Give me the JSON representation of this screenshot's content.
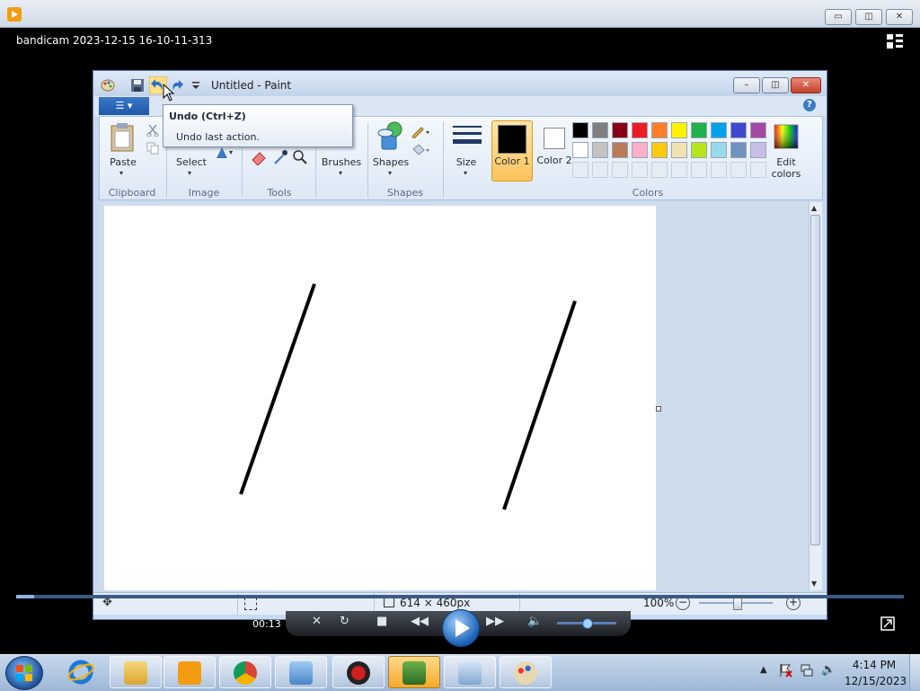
{
  "player": {
    "file_title": "bandicam 2023-12-15 16-10-11-313",
    "time_elapsed": "00:13",
    "progress": 0.02,
    "window_buttons": {
      "minimize": "▭",
      "restore": "◫",
      "close": "✕"
    }
  },
  "paint": {
    "title": "Untitled - Paint",
    "window_buttons": {
      "minimize": "–",
      "restore": "◫",
      "close": "✕"
    },
    "tooltip": {
      "title": "Undo (Ctrl+Z)",
      "description": "Undo last action."
    },
    "ribbon": {
      "paste_label": "Paste",
      "select_label": "Select",
      "brushes_label": "Brushes",
      "shapes_label": "Shapes",
      "size_label": "Size",
      "color1_label": "Color 1",
      "color2_label": "Color 2",
      "edit_colors_label": "Edit colors",
      "groups": {
        "clipboard": "Clipboard",
        "image": "Image",
        "tools": "Tools",
        "shapes": "Shapes",
        "colors": "Colors"
      },
      "color1": "#000000",
      "color2": "#ffffff"
    },
    "palette_row1": [
      "#000000",
      "#7f7f7f",
      "#880015",
      "#ed1c24",
      "#ff7f27",
      "#fff200",
      "#22b14c",
      "#00a2e8",
      "#3f48cc",
      "#a349a4"
    ],
    "palette_row2": [
      "#ffffff",
      "#c3c3c3",
      "#b97a57",
      "#ffaec9",
      "#ffc90e",
      "#efe4b0",
      "#b5e61d",
      "#99d9ea",
      "#7092be",
      "#c8bfe7"
    ],
    "status": {
      "canvas_size": "614 × 460px",
      "zoom": "100%"
    }
  },
  "taskbar": {
    "time": "4:14 PM",
    "date": "12/15/2023"
  }
}
